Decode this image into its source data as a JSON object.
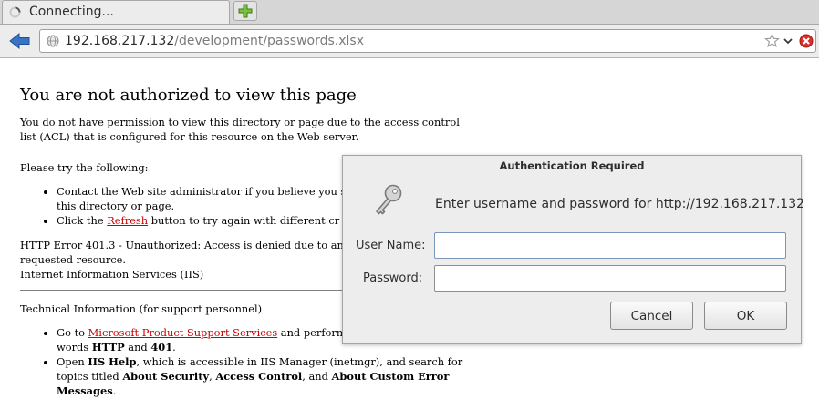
{
  "browser": {
    "tab_title": "Connecting...",
    "url_host": "192.168.217.132",
    "url_path": "/development/passwords.xlsx",
    "icons": [
      "loading-spinner-icon",
      "new-tab-plus-icon",
      "back-arrow-icon",
      "globe-icon",
      "bookmark-star-icon",
      "chevron-down-icon",
      "stop-icon"
    ]
  },
  "page": {
    "title": "You are not authorized to view this page",
    "intro": "You do not have permission to view this directory or page due to the access control list (ACL) that is configured for this resource on the Web server.",
    "try_heading": "Please try the following:",
    "try_items": {
      "contact": "Contact the Web site administrator if you believe you s",
      "contact_cont": "this directory or page.",
      "refresh_pre": "Click the ",
      "refresh_link": "Refresh",
      "refresh_post": " button to try again with different cr"
    },
    "error_line1": "HTTP Error 401.3 - Unauthorized: Access is denied due to an",
    "error_line2": "requested resource.",
    "server": "Internet Information Services (IIS)",
    "tech_heading": "Technical Information (for support personnel)",
    "tech_items": {
      "goto_pre": "Go to ",
      "goto_link": "Microsoft Product Support Services",
      "goto_post": " and perform",
      "goto_words_pre": "words ",
      "goto_http": "HTTP",
      "goto_and": " and ",
      "goto_401": "401",
      "goto_period": ".",
      "open_pre": "Open ",
      "open_iis_help": "IIS Help",
      "open_mid": ", which is accessible in IIS Manager (inetmgr), and search for topics titled ",
      "open_about_security": "About Security",
      "open_comma": ", ",
      "open_access_control": "Access Control",
      "open_and": ", and ",
      "open_custom_errors": "About Custom Error Messages",
      "open_period": "."
    },
    "link_color": "#cc0000"
  },
  "dialog": {
    "title": "Authentication Required",
    "message": "Enter username and password for http://192.168.217.132",
    "username_label": "User Name:",
    "username_value": "",
    "password_label": "Password:",
    "password_value": "",
    "cancel_label": "Cancel",
    "ok_label": "OK",
    "icon": "key-icon"
  }
}
